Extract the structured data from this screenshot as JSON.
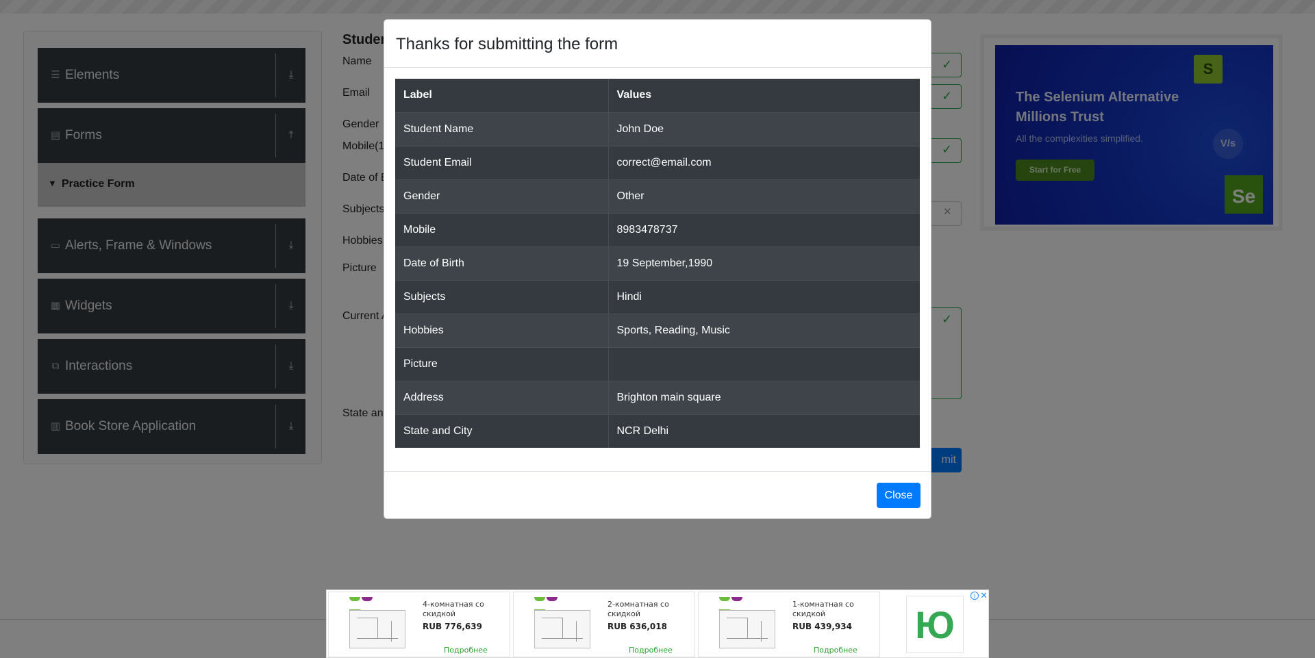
{
  "sidebar": {
    "groups": [
      {
        "label": "Elements",
        "icon": "list-icon",
        "arrow": "download-arrow-icon"
      },
      {
        "label": "Forms",
        "icon": "document-icon",
        "arrow": "upload-arrow-icon"
      },
      {
        "label": "Alerts, Frame & Windows",
        "icon": "window-icon",
        "arrow": "download-arrow-icon"
      },
      {
        "label": "Widgets",
        "icon": "widgets-icon",
        "arrow": "download-arrow-icon"
      },
      {
        "label": "Interactions",
        "icon": "interactions-icon",
        "arrow": "download-arrow-icon"
      },
      {
        "label": "Book Store Application",
        "icon": "books-icon",
        "arrow": "download-arrow-icon"
      }
    ],
    "active_item": "Practice Form"
  },
  "form": {
    "title": "Studen",
    "labels": [
      "Name",
      "Email",
      "Gender",
      "Mobile(1",
      "Date of B",
      "Subjects",
      "Hobbies",
      "Picture",
      "Current A",
      "State and"
    ],
    "submit_label": "mit"
  },
  "ad": {
    "title": "The Selenium Alternative Millions Trust",
    "subtitle": "All the complexities simplified.",
    "cta": "Start for Free",
    "logo_s": "S",
    "logo_se": "Se",
    "vs": "V/s"
  },
  "modal": {
    "title": "Thanks for submitting the form",
    "columns": [
      "Label",
      "Values"
    ],
    "rows": [
      [
        "Student Name",
        "John Doe"
      ],
      [
        "Student Email",
        "correct@email.com"
      ],
      [
        "Gender",
        "Other"
      ],
      [
        "Mobile",
        "8983478737"
      ],
      [
        "Date of Birth",
        "19 September,1990"
      ],
      [
        "Subjects",
        "Hindi"
      ],
      [
        "Hobbies",
        "Sports, Reading, Music"
      ],
      [
        "Picture",
        ""
      ],
      [
        "Address",
        "Brighton main square"
      ],
      [
        "State and City",
        "NCR Delhi"
      ]
    ],
    "close_label": "Close"
  },
  "bottom_ad": {
    "cards": [
      {
        "title": "4-комнатная со скидкой",
        "price": "RUB 776,639",
        "more": "Подробнее"
      },
      {
        "title": "2-комнатная со скидкой",
        "price": "RUB 636,018",
        "more": "Подробнее"
      },
      {
        "title": "1-комнатная со скидкой",
        "price": "RUB 439,934",
        "more": "Подробнее"
      }
    ],
    "brand": "Ю",
    "info": "i",
    "close": "✕"
  },
  "colors": {
    "primary": "#007bff",
    "success": "#28a745",
    "table_dark": "#343a40",
    "table_stripe": "#3e444a"
  }
}
